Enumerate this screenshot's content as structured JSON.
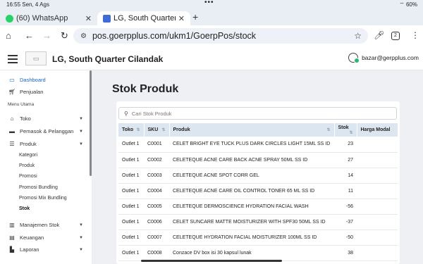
{
  "status_bar": {
    "time": "16:55  Sen, 4 Ags",
    "dots": "•••",
    "right": "⌔ 60%"
  },
  "browser": {
    "tabs": [
      {
        "title": "(60) WhatsApp",
        "icon": "whatsapp-icon",
        "color": "#25d366"
      },
      {
        "title": "LG, South Quarter",
        "icon": "app-favicon-icon",
        "color": "#3f6ad8"
      }
    ],
    "new_tab": "+",
    "url": "pos.goerpplus.com/ukm1/GoerpPos/stock",
    "tab_count": "2"
  },
  "app": {
    "store_name": "LG, South Quarter Cilandak",
    "user_email": "bazar@gerpplus.com"
  },
  "sidebar": {
    "dashboard": "Dashboard",
    "penjualan": "Penjualan",
    "menu_header": "Menu Utama",
    "toko": "Toko",
    "pemasok": "Pemasok & Pelanggan",
    "produk": "Produk",
    "sub_items": [
      "Kategori",
      "Produk",
      "Promosi",
      "Promosi Bundling",
      "Promosi Mix Bundling",
      "Stok"
    ],
    "manajemen_stok": "Manajemen Stok",
    "keuangan": "Keuangan",
    "laporan": "Laporan"
  },
  "page": {
    "title": "Stok Produk",
    "search_placeholder": "Cari Stok Produk"
  },
  "table": {
    "headers": [
      "Toko",
      "SKU",
      "Produk",
      "Stok",
      "Harga Modal"
    ],
    "rows": [
      [
        "Outlet 1",
        "C0001",
        "CELET BRIGHT EYE TUCK PLUS DARK CIRCLES LIGHT 15ML SS ID",
        "23"
      ],
      [
        "Outlet 1",
        "C0002",
        "CELETEQUE ACNE CARE BACK ACNE SPRAY 50ML SS ID",
        "27"
      ],
      [
        "Outlet 1",
        "C0003",
        "CELETEQUE ACNE SPOT CORR GEL",
        "14"
      ],
      [
        "Outlet 1",
        "C0004",
        "CELETEQUE ACNE CARE OIL CONTROL TONER 65 ML SS ID",
        "11"
      ],
      [
        "Outlet 1",
        "C0005",
        "CELETEQUE DERMOSCIENCE HYDRATION FACIAL WASH",
        "-56"
      ],
      [
        "Outlet 1",
        "C0006",
        "CELET SUNCARE MATTE MOISTURIZER WITH SPF30 50ML SS ID",
        "-37"
      ],
      [
        "Outlet 1",
        "C0007",
        "CELETEQUE HYDRATION FACIAL MOISTURIZER 100ML SS ID",
        "-50"
      ],
      [
        "Outlet 1",
        "C0008",
        "Conzace DV box isi 30 kapsul lunak",
        "38"
      ]
    ]
  }
}
